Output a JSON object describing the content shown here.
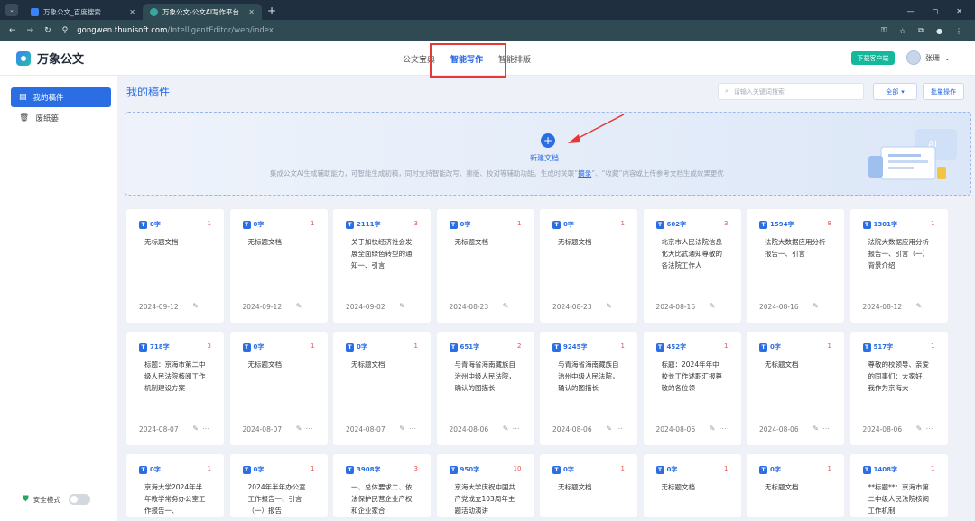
{
  "browser": {
    "tabs": [
      {
        "title": "万象公文_百度搜索",
        "active": false
      },
      {
        "title": "万象公文-公文AI写作平台",
        "active": true
      }
    ],
    "url_host": "gongwen.thunisoft.com",
    "url_path": "/IntelligentEditor/web/index"
  },
  "app": {
    "name": "万象公文",
    "nav": [
      "公文宝典",
      "智能写作",
      "智能排版"
    ],
    "active_nav": "智能写作",
    "download_label": "下载客户端",
    "user_name": "张珊"
  },
  "sidebar": {
    "items": [
      {
        "label": "我的稿件",
        "icon": "document-icon",
        "active": true
      },
      {
        "label": "废纸篓",
        "icon": "trash-icon",
        "active": false
      }
    ],
    "safe_mode_label": "安全模式"
  },
  "main": {
    "title": "我的稿件",
    "search_placeholder": "请输入关键词搜索",
    "filter_label": "全部",
    "batch_label": "批量操作",
    "create": {
      "label": "新建文档",
      "desc_before": "集成公文AI生成辅助能力，可智能生成初稿，同时支持智能改写、排版、校对等辅助功能。生成时关联“",
      "desc_link": "摘录",
      "desc_after": "”、“收藏”内容或上传参考文档生成效果更优"
    }
  },
  "docs": [
    {
      "words": "0字",
      "count": "1",
      "text": "无标题文档",
      "date": "2024-09-12"
    },
    {
      "words": "0字",
      "count": "1",
      "text": "无标题文档",
      "date": "2024-09-12"
    },
    {
      "words": "2111字",
      "count": "3",
      "text": "关于加快经济社会发展全面绿色转型的通知一、引言",
      "date": "2024-09-02"
    },
    {
      "words": "0字",
      "count": "1",
      "text": "无标题文档",
      "date": "2024-08-23"
    },
    {
      "words": "0字",
      "count": "1",
      "text": "无标题文档",
      "date": "2024-08-23"
    },
    {
      "words": "602字",
      "count": "3",
      "text": "北京市人民法院信息化大比武通知尊敬的各法院工作人",
      "date": "2024-08-16"
    },
    {
      "words": "1594字",
      "count": "8",
      "text": "法院大数据应用分析报告一、引言",
      "date": "2024-08-16"
    },
    {
      "words": "1301字",
      "count": "1",
      "text": "法院大数据应用分析报告一、引言（一）背景介绍",
      "date": "2024-08-12"
    },
    {
      "words": "718字",
      "count": "3",
      "text": "标题：京海市第二中级人民法院核阅工作机制建设方案",
      "date": "2024-08-07"
    },
    {
      "words": "0字",
      "count": "1",
      "text": "无标题文档",
      "date": "2024-08-07"
    },
    {
      "words": "0字",
      "count": "1",
      "text": "无标题文档",
      "date": "2024-08-07"
    },
    {
      "words": "651字",
      "count": "2",
      "text": "与青海省海南藏族自治州中级人民法院，确认的图描长",
      "date": "2024-08-06"
    },
    {
      "words": "9245字",
      "count": "1",
      "text": "与青海省海南藏族自治州中级人民法院，确认的图描长",
      "date": "2024-08-06"
    },
    {
      "words": "452字",
      "count": "1",
      "text": "标题：2024年年中校长工作述职汇报尊敬的各位领",
      "date": "2024-08-06"
    },
    {
      "words": "0字",
      "count": "1",
      "text": "无标题文档",
      "date": "2024-08-06"
    },
    {
      "words": "517字",
      "count": "1",
      "text": "尊敬的校领导、亲爱的同事们：大家好！我作为京海大",
      "date": "2024-08-06"
    },
    {
      "words": "0字",
      "count": "1",
      "text": "京海大学2024年半年教学常务办公室工作报告一、",
      "date": ""
    },
    {
      "words": "0字",
      "count": "1",
      "text": "2024年半年办公室工作报告一、引言（一）报告",
      "date": ""
    },
    {
      "words": "3908字",
      "count": "3",
      "text": "一、总体要求二、依法保护民营企业产权和企业家合",
      "date": ""
    },
    {
      "words": "950字",
      "count": "10",
      "text": "京海大学庆祝中国共产党成立103周年主题活动演讲",
      "date": ""
    },
    {
      "words": "0字",
      "count": "1",
      "text": "无标题文档",
      "date": ""
    },
    {
      "words": "0字",
      "count": "1",
      "text": "无标题文档",
      "date": ""
    },
    {
      "words": "0字",
      "count": "1",
      "text": "无标题文档",
      "date": ""
    },
    {
      "words": "1408字",
      "count": "1",
      "text": "**标题**：京海市第二中级人民法院核阅工作机制",
      "date": ""
    }
  ],
  "colors": {
    "accent": "#2b6de3",
    "count_red": "#e05252",
    "download_green": "#14b89a"
  }
}
